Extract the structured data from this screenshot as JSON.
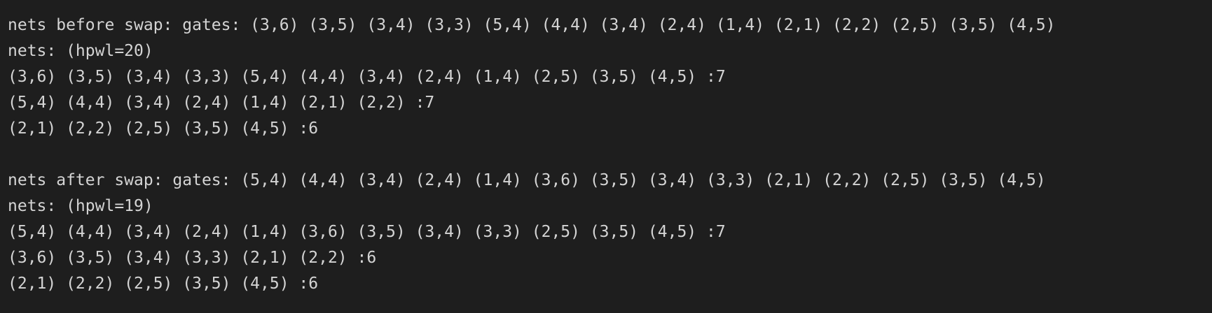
{
  "terminal": {
    "lines": [
      "nets before swap: gates: (3,6) (3,5) (3,4) (3,3) (5,4) (4,4) (3,4) (2,4) (1,4) (2,1) (2,2) (2,5) (3,5) (4,5)",
      "nets: (hpwl=20)",
      "(3,6) (3,5) (3,4) (3,3) (5,4) (4,4) (3,4) (2,4) (1,4) (2,5) (3,5) (4,5) :7",
      "(5,4) (4,4) (3,4) (2,4) (1,4) (2,1) (2,2) :7",
      "(2,1) (2,2) (2,5) (3,5) (4,5) :6",
      "",
      "nets after swap: gates: (5,4) (4,4) (3,4) (2,4) (1,4) (3,6) (3,5) (3,4) (3,3) (2,1) (2,2) (2,5) (3,5) (4,5)",
      "nets: (hpwl=19)",
      "(5,4) (4,4) (3,4) (2,4) (1,4) (3,6) (3,5) (3,4) (3,3) (2,5) (3,5) (4,5) :7",
      "(3,6) (3,5) (3,4) (3,3) (2,1) (2,2) :6",
      "(2,1) (2,2) (2,5) (3,5) (4,5) :6"
    ]
  }
}
